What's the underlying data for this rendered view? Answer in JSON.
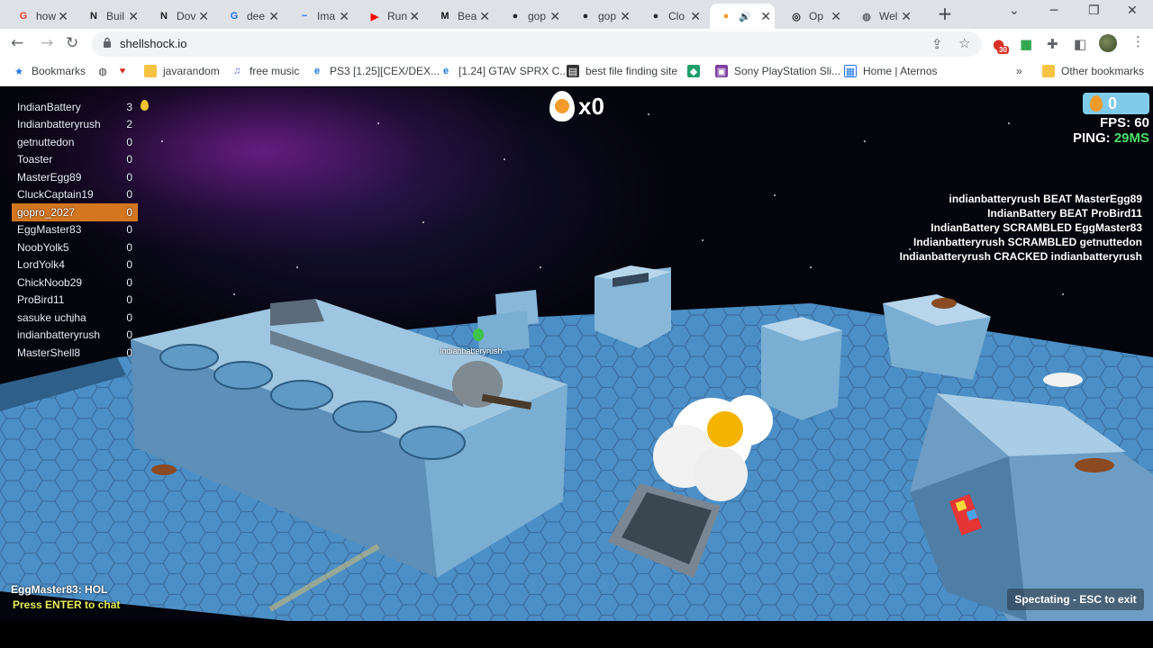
{
  "tabs": [
    {
      "label": "how",
      "favicon": "google-maps-icon",
      "color": "#e94235",
      "glyph": "G"
    },
    {
      "label": "Buil",
      "favicon": "nvidia-icon",
      "color": "#1a1a1a",
      "glyph": "N"
    },
    {
      "label": "Dov",
      "favicon": "nvidia-icon",
      "color": "#1a1a1a",
      "glyph": "N"
    },
    {
      "label": "dee",
      "favicon": "google-icon",
      "color": "#ffffff",
      "glyph": "G"
    },
    {
      "label": "Ima",
      "favicon": "trend-icon",
      "color": "#ffffff",
      "glyph": "~"
    },
    {
      "label": "Run",
      "favicon": "youtube-icon",
      "color": "#ff0000",
      "glyph": "▶"
    },
    {
      "label": "Bea",
      "favicon": "medium-icon",
      "color": "#111111",
      "glyph": "M"
    },
    {
      "label": "gop",
      "favicon": "github-icon",
      "color": "#24292e",
      "glyph": "●"
    },
    {
      "label": "gop",
      "favicon": "github-icon",
      "color": "#24292e",
      "glyph": "●"
    },
    {
      "label": "Clo",
      "favicon": "github-icon",
      "color": "#24292e",
      "glyph": "●"
    },
    {
      "label": "",
      "favicon": "shellshock-icon",
      "color": "#f29b2b",
      "glyph": "●"
    },
    {
      "label": "Op",
      "favicon": "openai-icon",
      "color": "#222222",
      "glyph": "◎"
    },
    {
      "label": "Wel",
      "favicon": "globe-icon",
      "color": "#5f6368",
      "glyph": "◍"
    }
  ],
  "address": {
    "url": "shellshock.io"
  },
  "extension_badge": "30",
  "bookmarks": {
    "items": [
      "Bookmarks",
      "",
      "",
      "javarandom",
      "free music",
      "PS3 [1.25][CEX/DEX...",
      "[1.24] GTAV SPRX C...",
      "best file finding site",
      "",
      "Sony PlayStation Sli...",
      "Home | Aternos"
    ],
    "other": "Other bookmarks"
  },
  "game": {
    "leaderboard": [
      {
        "name": "IndianBattery",
        "score": "3"
      },
      {
        "name": "Indianbatteryrush",
        "score": "2"
      },
      {
        "name": "getnuttedon",
        "score": "0"
      },
      {
        "name": "Toaster",
        "score": "0"
      },
      {
        "name": "MasterEgg89",
        "score": "0"
      },
      {
        "name": "CluckCaptain19",
        "score": "0"
      },
      {
        "name": "gopro_2027",
        "score": "0"
      },
      {
        "name": "EggMaster83",
        "score": "0"
      },
      {
        "name": "NoobYolk5",
        "score": "0"
      },
      {
        "name": "LordYolk4",
        "score": "0"
      },
      {
        "name": "ChickNoob29",
        "score": "0"
      },
      {
        "name": "ProBird11",
        "score": "0"
      },
      {
        "name": "sasuke uchiha",
        "score": "0"
      },
      {
        "name": "indianbatteryrush",
        "score": "0"
      },
      {
        "name": "MasterShell8",
        "score": "0"
      }
    ],
    "kill_count": "x0",
    "eggs": "0",
    "fps_label": "FPS: 60",
    "ping_label": "PING:",
    "ping_value": "29MS",
    "feed": [
      "indianbatteryrush BEAT MasterEgg89",
      "IndianBattery BEAT ProBird11",
      "IndianBattery SCRAMBLED EggMaster83",
      "Indianbatteryrush SCRAMBLED getnuttedon",
      "Indianbatteryrush CRACKED indianbatteryrush"
    ],
    "nametag": "Indianbatteryrush",
    "chat_line": "EggMaster83: HOL",
    "chat_prompt": "Press ENTER to chat",
    "spectate": "Spectating - ESC to exit"
  }
}
